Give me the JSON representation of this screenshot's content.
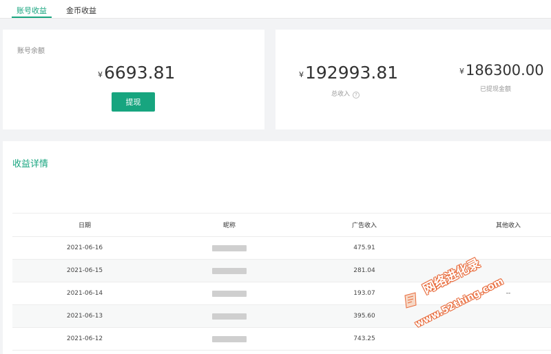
{
  "tabs": [
    {
      "label": "账号收益",
      "active": true
    },
    {
      "label": "金币收益",
      "active": false
    }
  ],
  "balance": {
    "label": "账号余额",
    "currency": "¥",
    "amount": "6693.81",
    "withdraw_label": "提现"
  },
  "income": {
    "total": {
      "currency": "¥",
      "amount": "192993.81",
      "label": "总收入",
      "help_icon": "question-circle-icon"
    },
    "withdrawn": {
      "currency": "¥",
      "amount": "186300.00",
      "label": "已提现金额"
    }
  },
  "detail": {
    "title": "收益详情",
    "columns": [
      "日期",
      "昵称",
      "广告收入",
      "其他收入"
    ],
    "rows": [
      {
        "date": "2021-06-16",
        "ad": "475.91",
        "other": ""
      },
      {
        "date": "2021-06-15",
        "ad": "281.04",
        "other": ""
      },
      {
        "date": "2021-06-14",
        "ad": "193.07",
        "other": "--"
      },
      {
        "date": "2021-06-13",
        "ad": "395.60",
        "other": ""
      },
      {
        "date": "2021-06-12",
        "ad": "743.25",
        "other": ""
      }
    ]
  },
  "watermark": {
    "line1": "网络进化录",
    "line2": "www.52thing.com"
  },
  "colors": {
    "accent": "#17a57f",
    "watermark": "#e86a3a"
  }
}
